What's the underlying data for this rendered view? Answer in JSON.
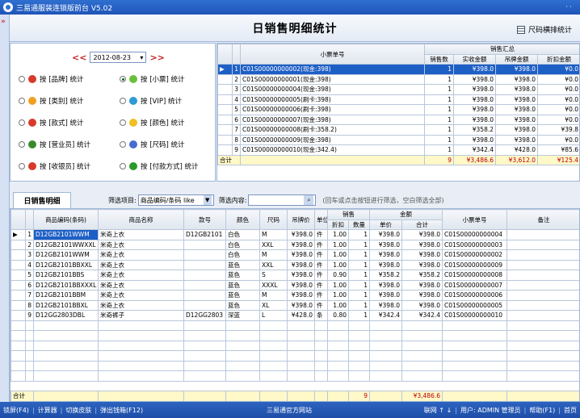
{
  "window": {
    "title": "三易通服装连锁版前台 V5.02"
  },
  "header": {
    "title": "日销售明细统计",
    "size_button": "尺码横排统计"
  },
  "date_bar": {
    "prev": "<<",
    "date": "2012-08-23",
    "next": ">>"
  },
  "options": [
    {
      "label": "按 [品牌] 统计",
      "selected": false,
      "icon_color": "#d83a2a"
    },
    {
      "label": "按 [小票] 统计",
      "selected": true,
      "icon_color": "#6cbf3b"
    },
    {
      "label": "按 [类别] 统计",
      "selected": false,
      "icon_color": "#f0a020"
    },
    {
      "label": "按 [VIP] 统计",
      "selected": false,
      "icon_color": "#2f9ad6"
    },
    {
      "label": "按 [款式] 统计",
      "selected": false,
      "icon_color": "#d83a2a"
    },
    {
      "label": "按 [颜色] 统计",
      "selected": false,
      "icon_color": "#f0c020"
    },
    {
      "label": "按 [营业员] 统计",
      "selected": false,
      "icon_color": "#3a8a2a"
    },
    {
      "label": "按 [尺码] 统计",
      "selected": false,
      "icon_color": "#4a6ad0"
    },
    {
      "label": "按 [收银员] 统计",
      "selected": false,
      "icon_color": "#d83a2a"
    },
    {
      "label": "按 [付款方式] 统计",
      "selected": false,
      "icon_color": "#2a9a2a"
    }
  ],
  "summary": {
    "headers": {
      "ticket": "小票单号",
      "group": "销售汇总",
      "qty": "销售数",
      "actual": "实收金额",
      "tag": "吊牌金额",
      "discount": "折扣金额"
    },
    "rows": [
      {
        "n": "1",
        "ticket": "C01S00000000002(现金:398)",
        "qty": "1",
        "actual": "¥398.0",
        "tag": "¥398.0",
        "discount": "¥0.0"
      },
      {
        "n": "2",
        "ticket": "C01S00000000001(现金:398)",
        "qty": "1",
        "actual": "¥398.0",
        "tag": "¥398.0",
        "discount": "¥0.0"
      },
      {
        "n": "3",
        "ticket": "C01S00000000004(现金:398)",
        "qty": "1",
        "actual": "¥398.0",
        "tag": "¥398.0",
        "discount": "¥0.0"
      },
      {
        "n": "4",
        "ticket": "C01S00000000005(刷卡:398)",
        "qty": "1",
        "actual": "¥398.0",
        "tag": "¥398.0",
        "discount": "¥0.0"
      },
      {
        "n": "5",
        "ticket": "C01S00000000006(刷卡:398)",
        "qty": "1",
        "actual": "¥398.0",
        "tag": "¥398.0",
        "discount": "¥0.0"
      },
      {
        "n": "6",
        "ticket": "C01S00000000007(现金:398)",
        "qty": "1",
        "actual": "¥398.0",
        "tag": "¥398.0",
        "discount": "¥0.0"
      },
      {
        "n": "7",
        "ticket": "C01S00000000008(刷卡:358.2)",
        "qty": "1",
        "actual": "¥358.2",
        "tag": "¥398.0",
        "discount": "¥39.8"
      },
      {
        "n": "8",
        "ticket": "C01S00000000009(现金:398)",
        "qty": "1",
        "actual": "¥398.0",
        "tag": "¥398.0",
        "discount": "¥0.0"
      },
      {
        "n": "9",
        "ticket": "C01S00000000010(现金:342.4)",
        "qty": "1",
        "actual": "¥342.4",
        "tag": "¥428.0",
        "discount": "¥85.6"
      }
    ],
    "total": {
      "label": "合计",
      "qty": "9",
      "actual": "¥3,486.6",
      "tag": "¥3,612.0",
      "discount": "¥125.4"
    }
  },
  "filter": {
    "tab": "日销售明细",
    "label": "筛选项目:",
    "field": "商品编码/条码 like",
    "content_label": "筛选内容:",
    "hint": "(回车或点击按钮进行筛选，空白筛选全部)"
  },
  "detail": {
    "headers": {
      "code": "商品编码(条码)",
      "name": "商品名称",
      "style": "款号",
      "color": "颜色",
      "size": "尺码",
      "tag_price": "吊牌价",
      "unit": "单位",
      "sales": "销售",
      "discount": "折扣",
      "qty": "数量",
      "amount": "金额",
      "price": "单价",
      "total": "合计",
      "ticket": "小票单号",
      "note": "备注"
    },
    "rows": [
      {
        "n": "1",
        "code": "D12GB2101WWM",
        "name": "米奇上衣",
        "style": "D12GB2101",
        "color": "白色",
        "size": "M",
        "tag_price": "¥398.0",
        "unit": "件",
        "discount": "1.00",
        "qty": "1",
        "price": "¥398.0",
        "total": "¥398.0",
        "ticket": "C01S00000000004"
      },
      {
        "n": "2",
        "code": "D12GB2101WWXXL",
        "name": "米奇上衣",
        "style": "",
        "color": "白色",
        "size": "XXL",
        "tag_price": "¥398.0",
        "unit": "件",
        "discount": "1.00",
        "qty": "1",
        "price": "¥398.0",
        "total": "¥398.0",
        "ticket": "C01S00000000003"
      },
      {
        "n": "3",
        "code": "D12GB2101WWM",
        "name": "米奇上衣",
        "style": "",
        "color": "白色",
        "size": "M",
        "tag_price": "¥398.0",
        "unit": "件",
        "discount": "1.00",
        "qty": "1",
        "price": "¥398.0",
        "total": "¥398.0",
        "ticket": "C01S00000000002"
      },
      {
        "n": "4",
        "code": "D12GB2101BBXXL",
        "name": "米奇上衣",
        "style": "",
        "color": "蓝色",
        "size": "XXL",
        "tag_price": "¥398.0",
        "unit": "件",
        "discount": "1.00",
        "qty": "1",
        "price": "¥398.0",
        "total": "¥398.0",
        "ticket": "C01S00000000009"
      },
      {
        "n": "5",
        "code": "D12GB2101BBS",
        "name": "米奇上衣",
        "style": "",
        "color": "蓝色",
        "size": "S",
        "tag_price": "¥398.0",
        "unit": "件",
        "discount": "0.90",
        "qty": "1",
        "price": "¥358.2",
        "total": "¥358.2",
        "ticket": "C01S00000000008"
      },
      {
        "n": "6",
        "code": "D12GB2101BBXXXL",
        "name": "米奇上衣",
        "style": "",
        "color": "蓝色",
        "size": "XXXL",
        "tag_price": "¥398.0",
        "unit": "件",
        "discount": "1.00",
        "qty": "1",
        "price": "¥398.0",
        "total": "¥398.0",
        "ticket": "C01S00000000007"
      },
      {
        "n": "7",
        "code": "D12GB2101BBM",
        "name": "米奇上衣",
        "style": "",
        "color": "蓝色",
        "size": "M",
        "tag_price": "¥398.0",
        "unit": "件",
        "discount": "1.00",
        "qty": "1",
        "price": "¥398.0",
        "total": "¥398.0",
        "ticket": "C01S00000000006"
      },
      {
        "n": "8",
        "code": "D12GB2101BBXL",
        "name": "米奇上衣",
        "style": "",
        "color": "蓝色",
        "size": "XL",
        "tag_price": "¥398.0",
        "unit": "件",
        "discount": "1.00",
        "qty": "1",
        "price": "¥398.0",
        "total": "¥398.0",
        "ticket": "C01S00000000005"
      },
      {
        "n": "9",
        "code": "D12GG2803DBL",
        "name": "米奇裤子",
        "style": "D12GG2803",
        "color": "深蓝",
        "size": "L",
        "tag_price": "¥428.0",
        "unit": "条",
        "discount": "0.80",
        "qty": "1",
        "price": "¥342.4",
        "total": "¥342.4",
        "ticket": "C01S00000000010"
      }
    ],
    "total": {
      "label": "合计",
      "qty": "9",
      "total": "¥3,486.6"
    }
  },
  "statusbar": {
    "lock": "锁屏(F4)",
    "calc": "计算器",
    "skin": "切换皮肤",
    "cashbox": "弹出钱箱(F12)",
    "site": "三易通官方网站",
    "online": "联网 ↑ ↓",
    "user": "用户: ADMIN 管理员",
    "help": "帮助(F1)",
    "home": "首页"
  }
}
